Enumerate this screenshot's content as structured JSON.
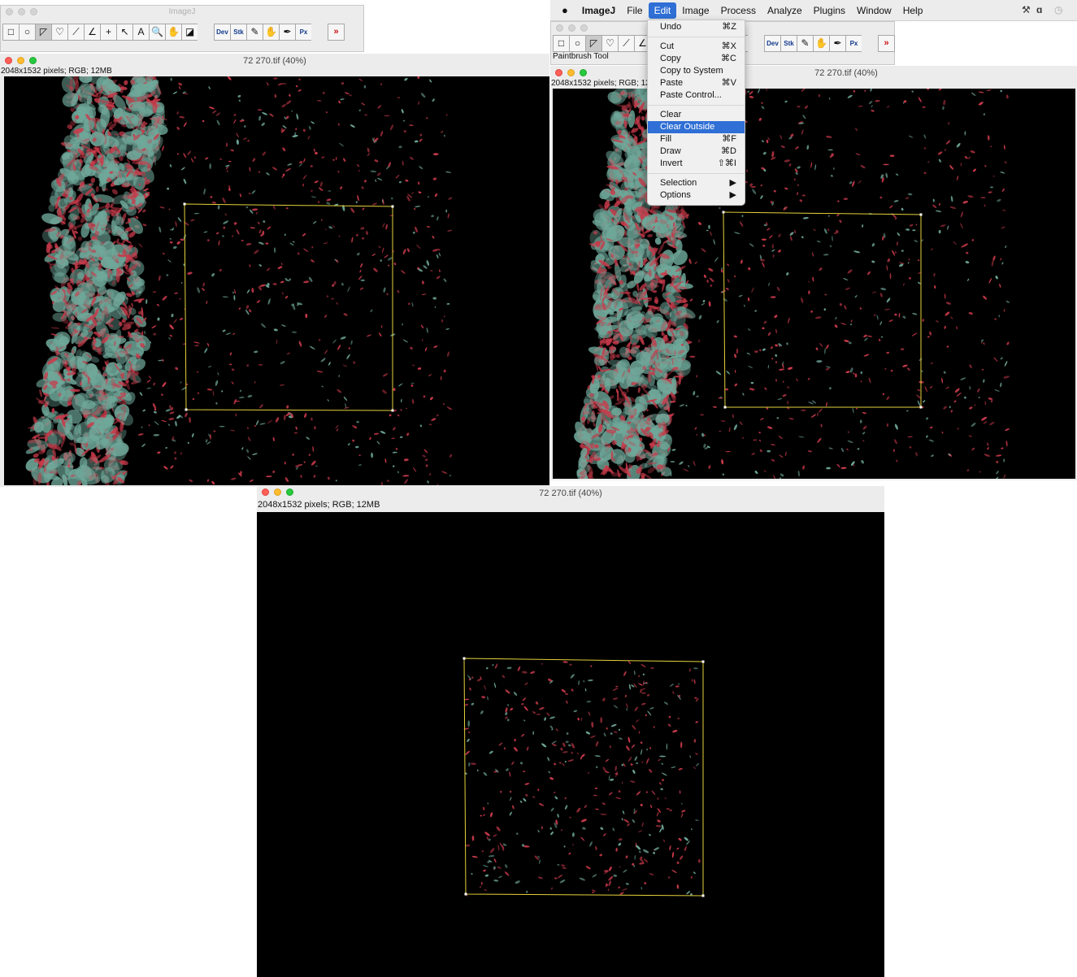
{
  "toolbar_left": {
    "title": "ImageJ",
    "tools": [
      "rect-tool",
      "oval-tool",
      "polygon-tool",
      "freehand-tool",
      "line-tool",
      "angle-tool",
      "point-tool",
      "wand-tool",
      "text-tool",
      "magnifier-tool",
      "hand-tool",
      "dropper-tool",
      "gap",
      "dev-tool",
      "stk-tool",
      "brush-tool",
      "flood-tool",
      "pen-tool",
      "px-tool",
      "gap",
      "more-tools"
    ],
    "tool_glyphs": [
      "□",
      "○",
      "◸",
      "♡",
      "⟋",
      "∠",
      "+",
      "↖",
      "A",
      "🔍",
      "✋",
      "◪",
      "",
      "Dev",
      "Stk",
      "✎",
      "✋",
      "✒",
      "Px",
      "",
      "»"
    ]
  },
  "toolbar_right": {
    "status": "Paintbrush Tool",
    "tool_glyphs": [
      "□",
      "○",
      "◸",
      "♡",
      "⟋",
      "∠",
      "",
      "",
      "",
      "",
      "",
      "",
      "",
      "Dev",
      "Stk",
      "✎",
      "✋",
      "✒",
      "Px",
      "",
      "»"
    ]
  },
  "menubar": {
    "apple": "",
    "items": [
      "ImageJ",
      "File",
      "Edit",
      "Image",
      "Process",
      "Analyze",
      "Plugins",
      "Window",
      "Help"
    ],
    "active": "Edit",
    "right_icons": [
      "wrench-icon",
      "script-icon",
      "time-machine-icon"
    ],
    "right_glyphs": [
      "⚒",
      "ɑ",
      "◷"
    ]
  },
  "edit_menu": {
    "groups": [
      [
        {
          "label": "Undo",
          "shortcut": "⌘Z"
        }
      ],
      [
        {
          "label": "Cut",
          "shortcut": "⌘X"
        },
        {
          "label": "Copy",
          "shortcut": "⌘C"
        },
        {
          "label": "Copy to System",
          "shortcut": ""
        },
        {
          "label": "Paste",
          "shortcut": "⌘V"
        },
        {
          "label": "Paste Control...",
          "shortcut": ""
        }
      ],
      [
        {
          "label": "Clear",
          "shortcut": ""
        },
        {
          "label": "Clear Outside",
          "shortcut": "",
          "highlighted": true
        },
        {
          "label": "Fill",
          "shortcut": "⌘F"
        },
        {
          "label": "Draw",
          "shortcut": "⌘D"
        },
        {
          "label": "Invert",
          "shortcut": "⇧⌘I"
        }
      ],
      [
        {
          "label": "Selection",
          "shortcut": "▶"
        },
        {
          "label": "Options",
          "shortcut": "▶"
        }
      ]
    ]
  },
  "windows": {
    "left": {
      "title": "72 270.tif (40%)",
      "info": "2048x1532 pixels; RGB; 12MB"
    },
    "right": {
      "title": "72 270.tif (40%)",
      "info": "2048x1532 pixels; RGB; 12MB"
    },
    "bottom": {
      "title": "72 270.tif (40%)",
      "info": "2048x1532 pixels; RGB; 12MB"
    }
  },
  "colors": {
    "selection": "#e6d23a",
    "highlight": "#2f6fd6",
    "tissue_red": "#c83a4a",
    "tissue_green": "#6fa89a"
  }
}
